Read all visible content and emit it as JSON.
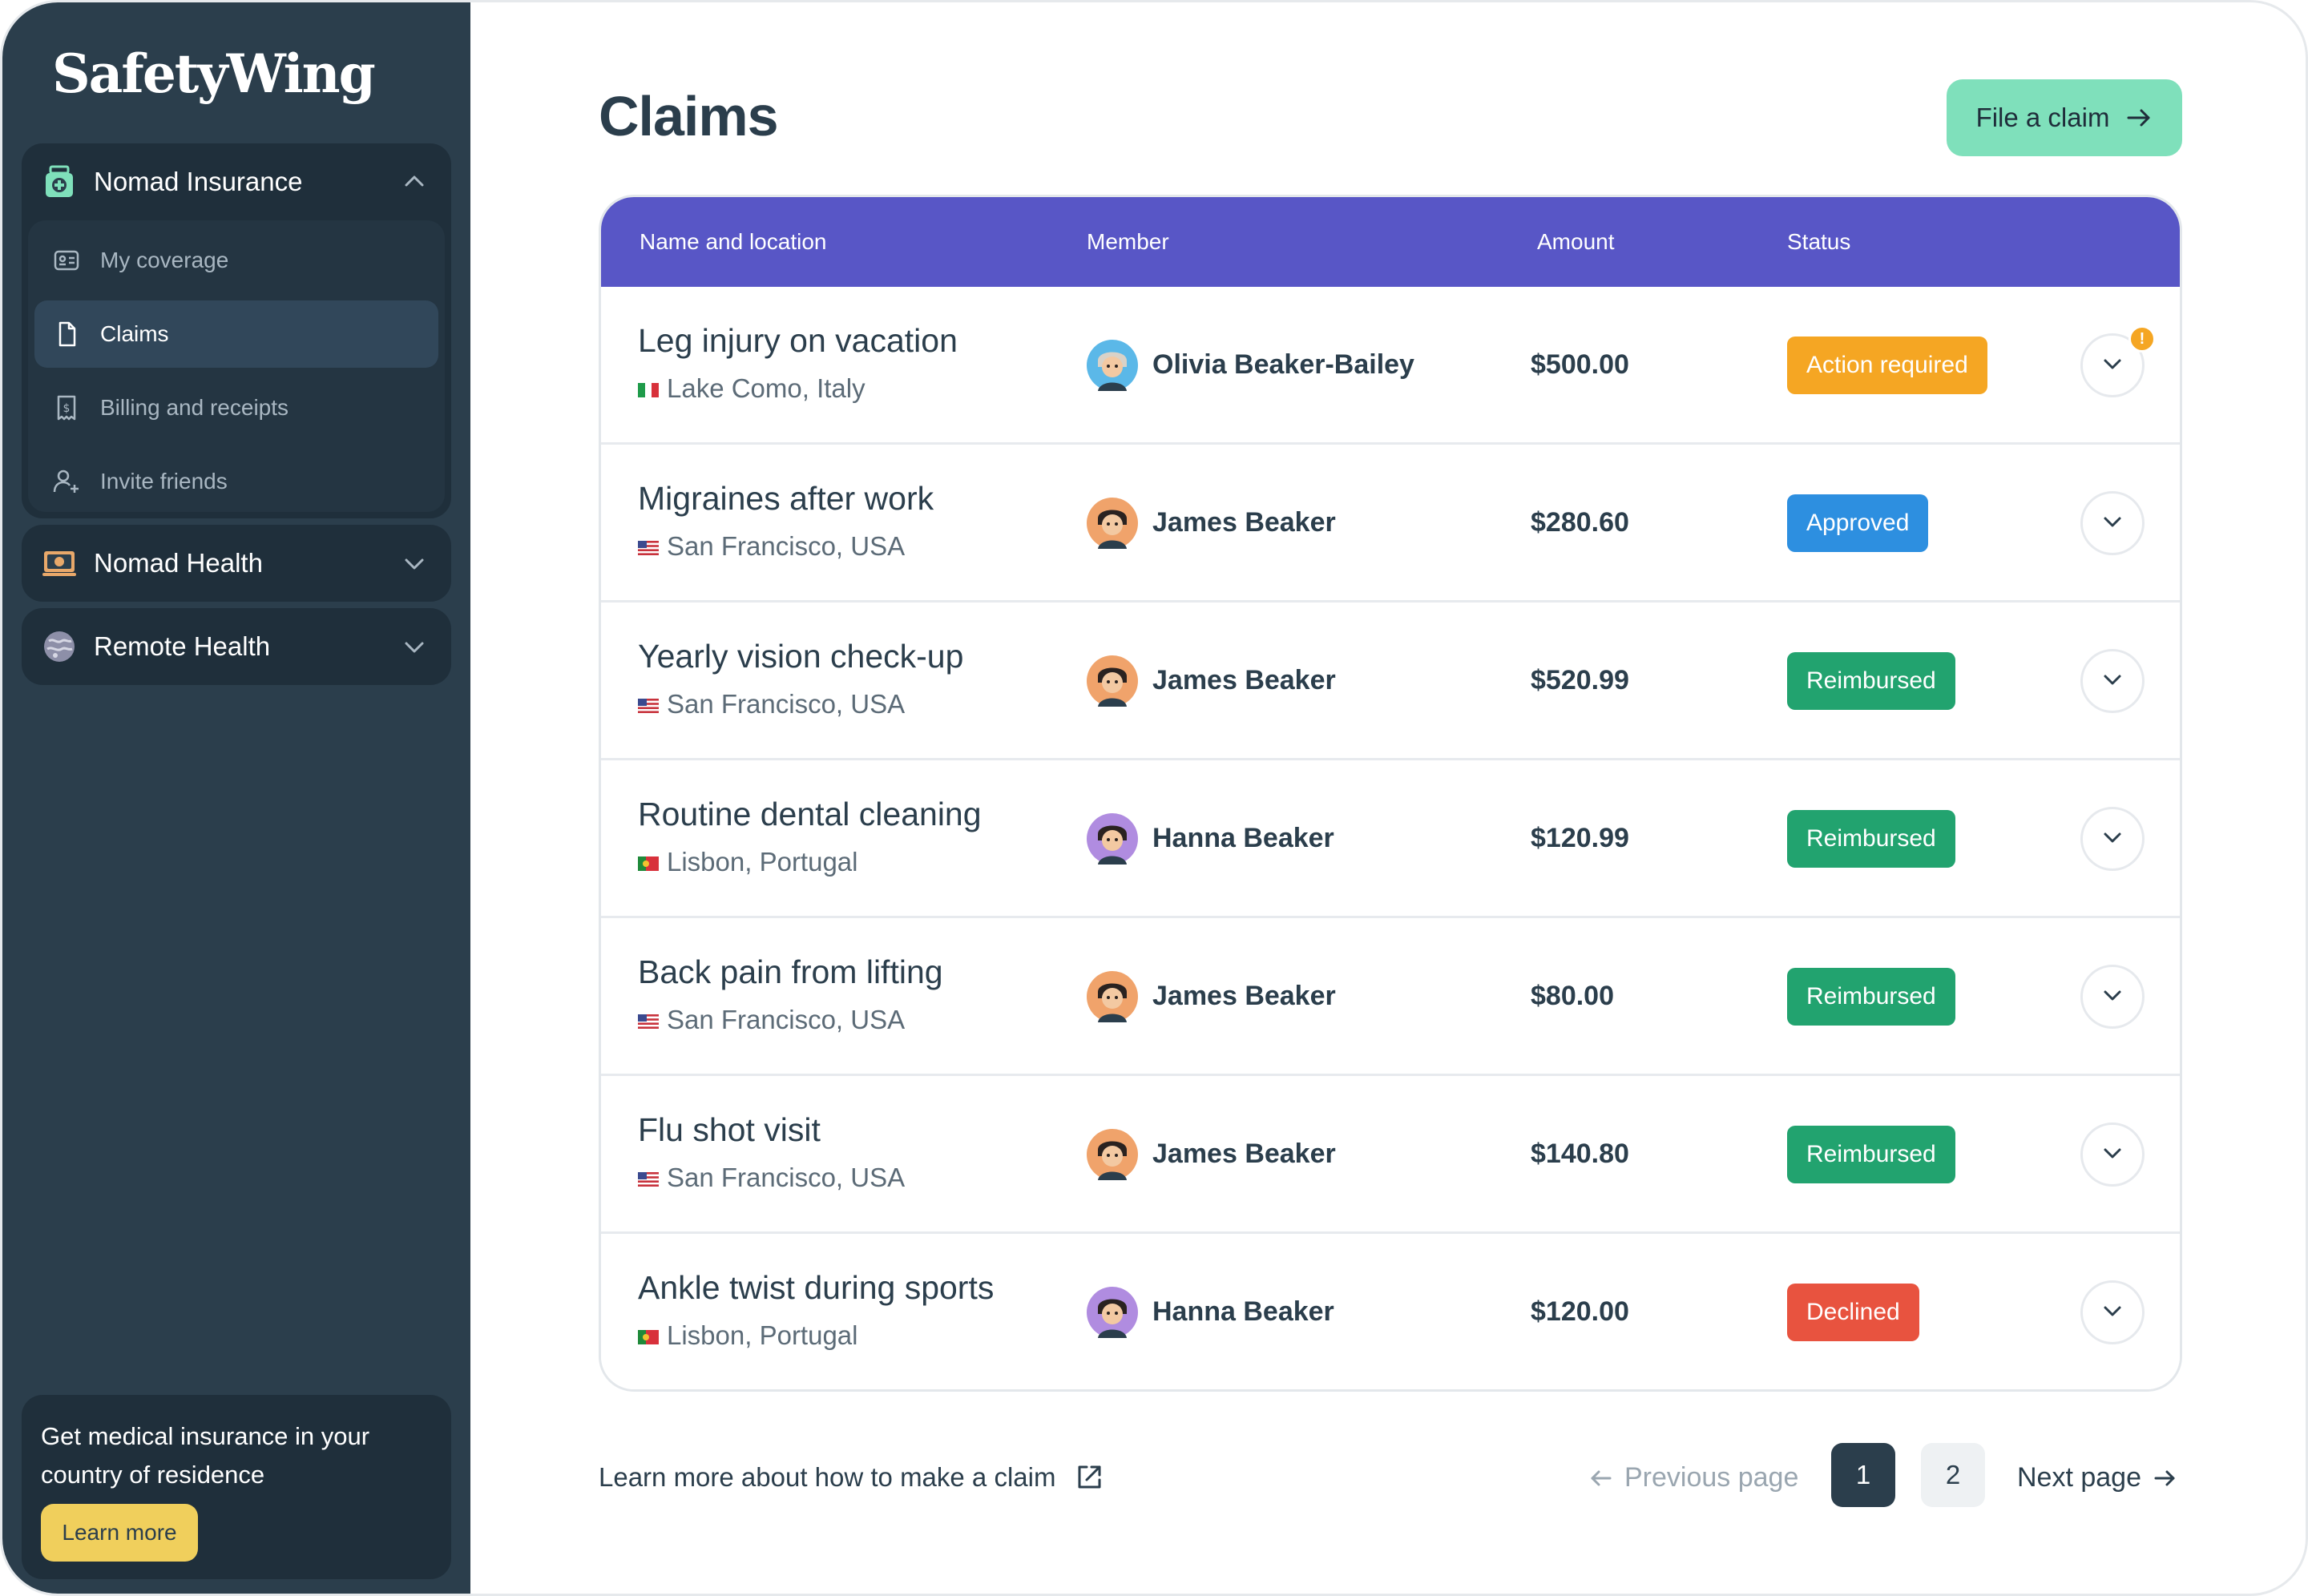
{
  "app": {
    "logo_text": "SafetyWing"
  },
  "sidebar": {
    "groups": [
      {
        "label": "Nomad Insurance",
        "icon": "medical-bag-icon",
        "expanded": true,
        "items": [
          {
            "label": "My coverage",
            "icon": "id-card-icon",
            "active": false
          },
          {
            "label": "Claims",
            "icon": "document-icon",
            "active": true
          },
          {
            "label": "Billing and receipts",
            "icon": "receipt-icon",
            "active": false
          },
          {
            "label": "Invite friends",
            "icon": "add-user-icon",
            "active": false
          }
        ]
      },
      {
        "label": "Nomad Health",
        "icon": "laptop-health-icon",
        "expanded": false
      },
      {
        "label": "Remote Health",
        "icon": "globe-icon",
        "expanded": false
      }
    ],
    "promo": {
      "text": "Get medical insurance in your country of residence",
      "button_label": "Learn more"
    }
  },
  "main": {
    "title": "Claims",
    "file_claim_label": "File a claim",
    "table": {
      "headers": [
        "Name and location",
        "Member",
        "Amount",
        "Status"
      ],
      "rows": [
        {
          "title": "Leg injury on vacation",
          "location": "Lake Como, Italy",
          "flag": "italy",
          "member": "Olivia Beaker-Bailey",
          "avatar": "olivia",
          "amount": "$500.00",
          "status": "Action required",
          "status_color": "#f5a623",
          "alert": true
        },
        {
          "title": "Migraines after work",
          "location": "San Francisco, USA",
          "flag": "usa",
          "member": "James Beaker",
          "avatar": "james",
          "amount": "$280.60",
          "status": "Approved",
          "status_color": "#2d8fe0",
          "alert": false
        },
        {
          "title": "Yearly vision check-up",
          "location": "San Francisco, USA",
          "flag": "usa",
          "member": "James Beaker",
          "avatar": "james",
          "amount": "$520.99",
          "status": "Reimbursed",
          "status_color": "#22a36f",
          "alert": false
        },
        {
          "title": "Routine dental cleaning",
          "location": "Lisbon, Portugal",
          "flag": "portugal",
          "member": "Hanna Beaker",
          "avatar": "hanna",
          "amount": "$120.99",
          "status": "Reimbursed",
          "status_color": "#22a36f",
          "alert": false
        },
        {
          "title": "Back pain from lifting",
          "location": "San Francisco, USA",
          "flag": "usa",
          "member": "James Beaker",
          "avatar": "james",
          "amount": "$80.00",
          "status": "Reimbursed",
          "status_color": "#22a36f",
          "alert": false
        },
        {
          "title": "Flu shot visit",
          "location": "San Francisco, USA",
          "flag": "usa",
          "member": "James Beaker",
          "avatar": "james",
          "amount": "$140.80",
          "status": "Reimbursed",
          "status_color": "#22a36f",
          "alert": false
        },
        {
          "title": "Ankle twist during sports",
          "location": "Lisbon, Portugal",
          "flag": "portugal",
          "member": "Hanna Beaker",
          "avatar": "hanna",
          "amount": "$120.00",
          "status": "Declined",
          "status_color": "#e8533f",
          "alert": false
        }
      ]
    },
    "alert_mark": "!"
  },
  "footer": {
    "learn_link": "Learn more about how to make a claim",
    "prev_label": "Previous page",
    "next_label": "Next page",
    "pages": [
      "1",
      "2"
    ],
    "current_page": "1"
  },
  "colors": {
    "sidebar_bg": "#2b3e4c",
    "table_header": "#5856c6",
    "cta": "#7fe0bb",
    "promo_button": "#f0cf5c"
  }
}
